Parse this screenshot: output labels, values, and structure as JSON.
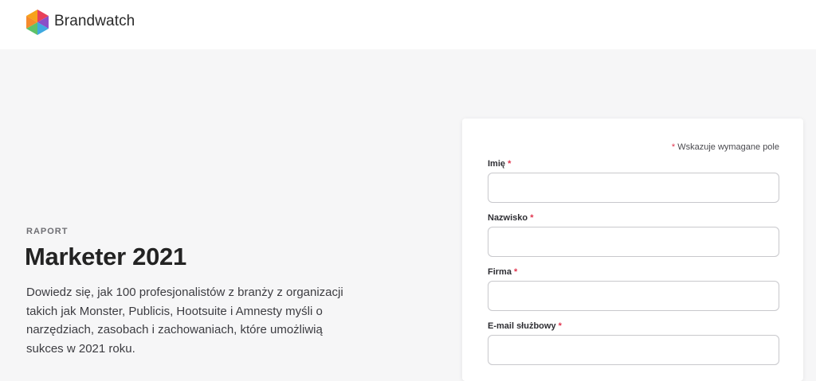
{
  "header": {
    "brand_name": "Brandwatch"
  },
  "hero": {
    "eyebrow": "RAPORT",
    "title": "Marketer 2021",
    "description": "Dowiedz się, jak 100 profesjonalistów z branży z organizacji takich jak Monster, Publicis, Hootsuite i Amnesty myśli o narzędziach, zasobach i zachowaniach, które umożliwią sukces w 2021 roku."
  },
  "form": {
    "required_marker": "*",
    "required_note": "Wskazuje wymagane pole",
    "fields": [
      {
        "label": "Imię",
        "value": "",
        "placeholder": ""
      },
      {
        "label": "Nazwisko",
        "value": "",
        "placeholder": ""
      },
      {
        "label": "Firma",
        "value": "",
        "placeholder": ""
      },
      {
        "label": "E-mail służbowy",
        "value": "",
        "placeholder": ""
      }
    ]
  },
  "colors": {
    "required": "#e0334d",
    "background": "#f6f6f7",
    "card": "#ffffff",
    "logo": [
      "#f7a21b",
      "#e8405a",
      "#8a4fc8",
      "#3fa9e0",
      "#5dc26a"
    ]
  }
}
